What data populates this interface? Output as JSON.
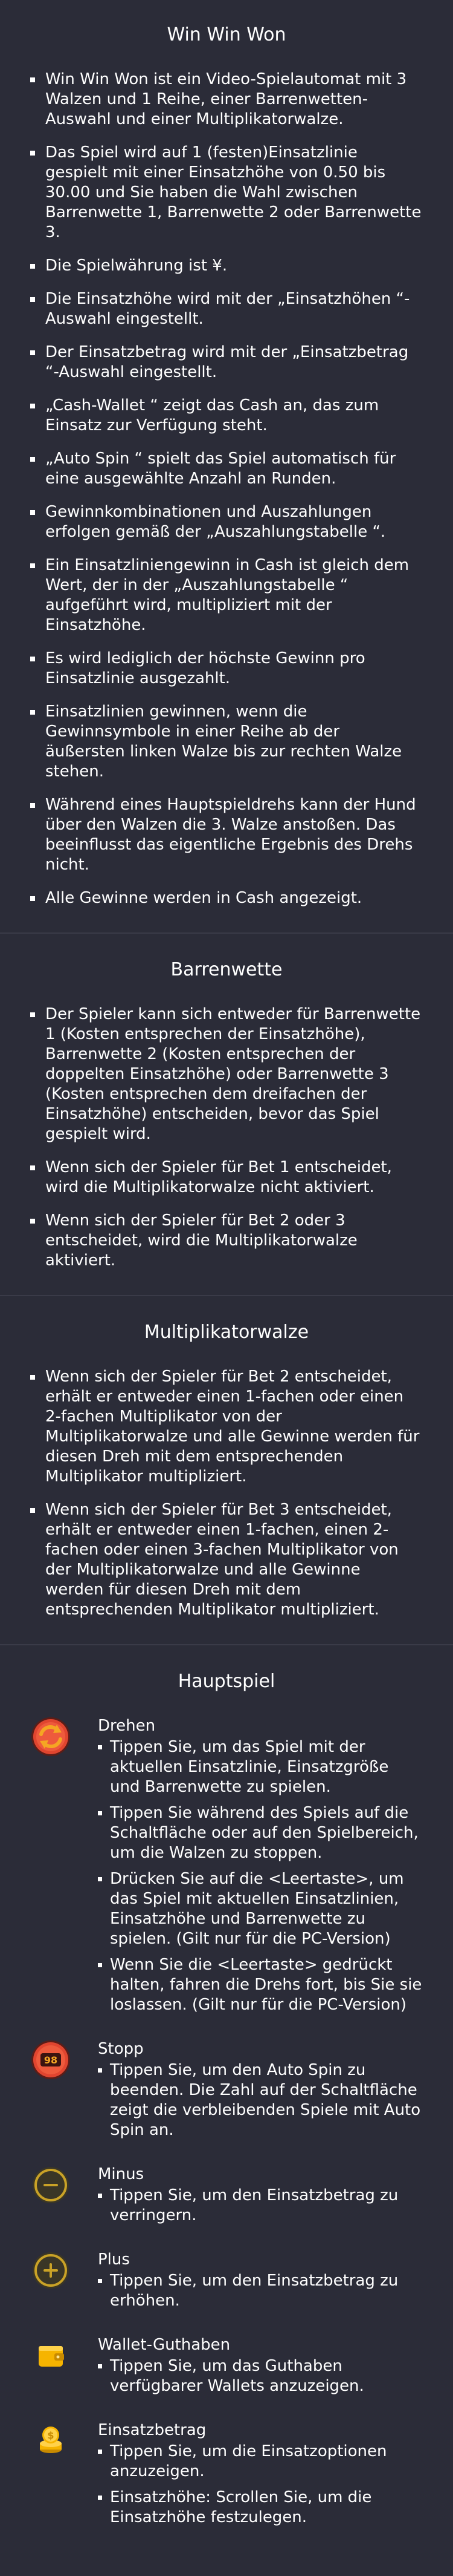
{
  "overview": {
    "title": "Win Win Won",
    "items": [
      "Win Win Won ist ein Video-Spielautomat mit 3 Walzen und 1 Reihe, einer Barrenwetten-Auswahl und einer Multiplikatorwalze.",
      "Das Spiel wird auf 1 (festen)Einsatzlinie gespielt mit einer Einsatzhöhe von 0.50 bis 30.00 und Sie haben die Wahl zwischen Barrenwette 1, Barrenwette 2 oder Barrenwette 3.",
      "Die Spielwährung ist ¥.",
      "Die Einsatzhöhe wird mit der „Einsatzhöhen “-Auswahl eingestellt.",
      "Der Einsatzbetrag wird mit der „Einsatzbetrag “-Auswahl eingestellt.",
      "„Cash-Wallet “ zeigt das Cash an, das zum Einsatz zur Verfügung steht.",
      "„Auto Spin “ spielt das Spiel automatisch für eine ausgewählte Anzahl an Runden.",
      "Gewinnkombinationen und Auszahlungen erfolgen gemäß der „Auszahlungstabelle “.",
      "Ein Einsatzliniengewinn in Cash ist gleich dem Wert, der in der „Auszahlungstabelle “ aufgeführt wird, multipliziert mit der Einsatzhöhe.",
      "Es wird lediglich der höchste Gewinn pro Einsatzlinie ausgezahlt.",
      "Einsatzlinien gewinnen, wenn die Gewinnsymbole in einer Reihe ab der äußersten linken Walze bis zur rechten Walze stehen.",
      "Während eines Hauptspieldrehs kann der Hund über den Walzen die 3. Walze anstoßen. Das beeinflusst das eigentliche Ergebnis des Drehs nicht.",
      "Alle Gewinne werden in Cash angezeigt."
    ]
  },
  "barrenwette": {
    "title": "Barrenwette",
    "items": [
      "Der Spieler kann sich entweder für Barrenwette 1 (Kosten entsprechen der Einsatzhöhe), Barrenwette 2 (Kosten entsprechen der doppelten Einsatzhöhe) oder Barrenwette 3 (Kosten entsprechen dem dreifachen der Einsatzhöhe) entscheiden, bevor das Spiel gespielt wird.",
      "Wenn sich der Spieler für Bet 1 entscheidet, wird die Multiplikatorwalze nicht aktiviert.",
      "Wenn sich der Spieler für Bet 2 oder 3 entscheidet, wird die Multiplikatorwalze aktiviert."
    ]
  },
  "multiplikator": {
    "title": "Multiplikatorwalze",
    "items": [
      "Wenn sich der Spieler für Bet 2 entscheidet, erhält er entweder einen 1-fachen oder einen 2-fachen Multiplikator von der Multiplikatorwalze und alle Gewinne werden für diesen Dreh mit dem entsprechenden Multiplikator multipliziert.",
      "Wenn sich der Spieler für Bet 3 entscheidet, erhält er entweder einen 1-fachen, einen 2-fachen oder einen 3-fachen Multiplikator von der Multiplikatorwalze und alle Gewinne werden für diesen Dreh mit dem entsprechenden Multiplikator multipliziert."
    ]
  },
  "hauptspiel": {
    "title": "Hauptspiel",
    "features": [
      {
        "icon": "spin-icon",
        "name": "Drehen",
        "items": [
          "Tippen Sie, um das Spiel mit der aktuellen Einsatzlinie, Einsatzgröße und Barrenwette zu spielen.",
          "Tippen Sie während des Spiels auf die Schaltfläche oder auf den Spielbereich, um die Walzen zu stoppen.",
          "Drücken Sie auf die <Leertaste>, um das Spiel mit aktuellen Einsatzlinien, Einsatzhöhe und Barrenwette zu spielen. (Gilt nur für die PC-Version)",
          "Wenn Sie die <Leertaste> gedrückt halten, fahren die Drehs fort, bis Sie sie loslassen. (Gilt nur für die PC-Version)"
        ]
      },
      {
        "icon": "stop-icon",
        "badge": "98",
        "name": "Stopp",
        "items": [
          "Tippen Sie, um den Auto Spin zu beenden. Die Zahl auf der Schaltfläche zeigt die verbleibenden Spiele mit Auto Spin an."
        ]
      },
      {
        "icon": "minus-icon",
        "name": "Minus",
        "items": [
          "Tippen Sie, um den Einsatzbetrag zu verringern."
        ]
      },
      {
        "icon": "plus-icon",
        "name": "Plus",
        "items": [
          "Tippen Sie, um den Einsatzbetrag zu erhöhen."
        ]
      },
      {
        "icon": "wallet-icon",
        "name": "Wallet-Guthaben",
        "items": [
          "Tippen Sie, um das Guthaben verfügbarer Wallets anzuzeigen."
        ]
      },
      {
        "icon": "coins-icon",
        "name": "Einsatzbetrag",
        "items": [
          "Tippen Sie, um die Einsatzoptionen anzuzeigen.",
          "Einsatzhöhe: Scrollen Sie, um die Einsatzhöhe festzulegen."
        ]
      }
    ]
  },
  "colors": {
    "background": "#2b2c38",
    "divider": "#3a3b48",
    "spin_red": "#e0452f",
    "spin_orange": "#f5a623",
    "gold": "#c9a227",
    "wallet_yellow": "#f6b400"
  }
}
